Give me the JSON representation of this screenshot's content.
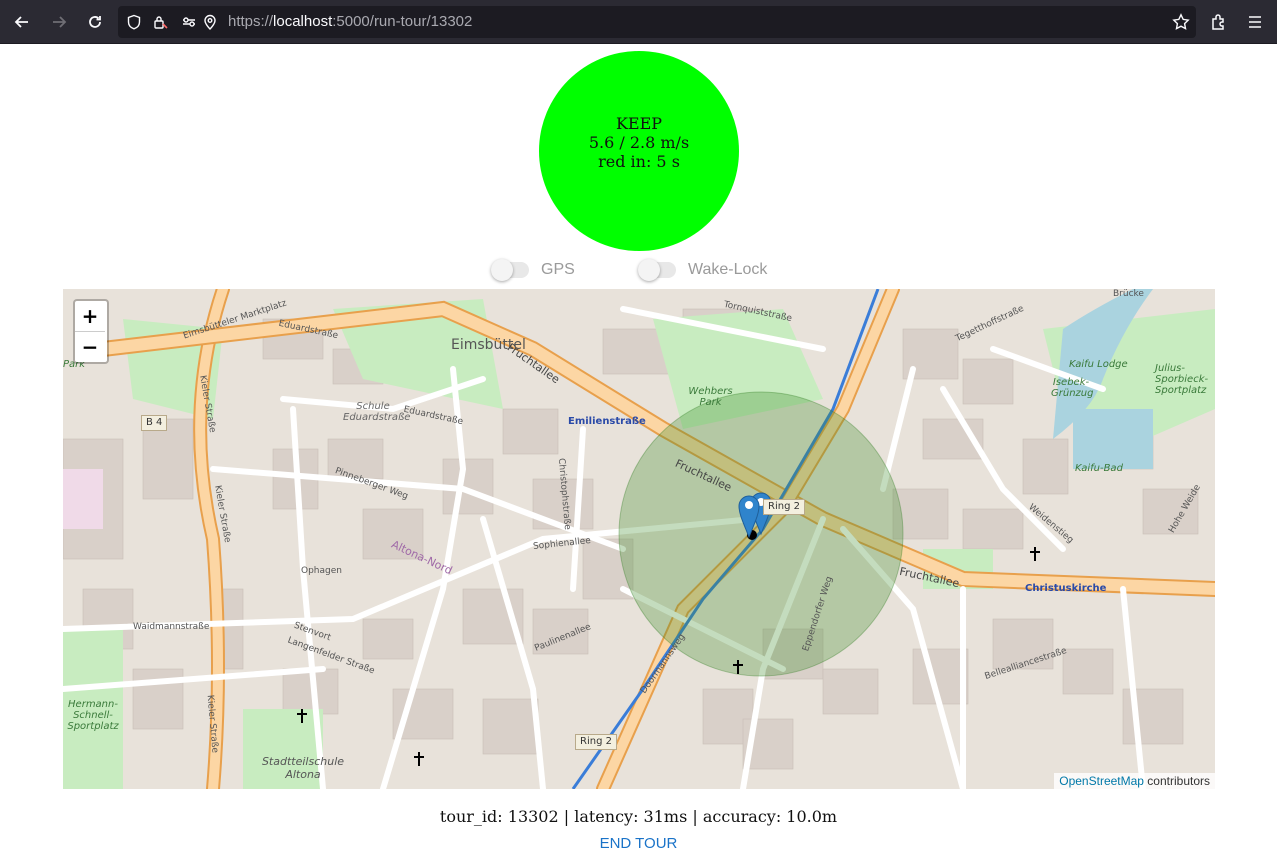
{
  "browser": {
    "url_prefix": "https://",
    "url_host": "localhost",
    "url_rest": ":5000/run-tour/13302",
    "icons": [
      "back-arrow-icon",
      "forward-arrow-icon",
      "reload-icon",
      "shield-icon",
      "lock-icon",
      "permissions-icon",
      "location-icon",
      "star-icon",
      "extensions-icon",
      "menu-icon"
    ]
  },
  "status": {
    "line1": "KEEP",
    "line2": "5.6 / 2.8 m/s",
    "line3": "red in: 5 s",
    "color": "#00ff00"
  },
  "toggles": {
    "gps": {
      "label": "GPS",
      "on": false
    },
    "wakelock": {
      "label": "Wake-Lock",
      "on": false
    }
  },
  "map": {
    "zoom_in": "+",
    "zoom_out": "−",
    "attribution_link": "OpenStreetMap",
    "attribution_text": " contributors",
    "labels": {
      "eimsbuettel": "Eimsbüttel",
      "fruchtallee1": "Fruchtallee",
      "fruchtallee2": "Fruchtallee",
      "fruchtallee3": "Fruchtallee",
      "emilienstrasse": "Emilienstraße",
      "wehbers_park": "Wehbers Park",
      "christuskirche": "Christuskirche",
      "kaifu_lodge": "Kaifu Lodge",
      "julius_sportplatz": "Julius-Sporbieck-Sportplatz",
      "isebek": "Isebek-Grünzug",
      "kaifu_bad": "Kaifu-Bad",
      "marktplatz": "Eimsbütteler Marktplatz",
      "eduardstrasse1": "Eduardstraße",
      "eduardstrasse2": "Eduardstraße",
      "schule": "Schule Eduardstraße",
      "kieler1": "Kieler Straße",
      "kieler2": "Kieler Straße",
      "kieler3": "Kieler Straße",
      "pinneberger": "Pinneberger Weg",
      "sophienallee": "Sophienallee",
      "ophagen": "Ophagen",
      "altona_nord": "Altona-Nord",
      "stadtteilschule": "Stadtteilschule Altona",
      "hermann": "Hermann-Schnell-Sportplatz",
      "waidmann": "Waidmannstraße",
      "langenfelder": "Langenfelder Straße",
      "paulinenallee": "Paulinenallee",
      "eppendorfer": "Eppendorfer Weg",
      "doormannsweg": "Doormannsweg",
      "christophstr": "Christophstraße",
      "tornquist": "Tornquiststraße",
      "tegetthoff": "Tegetthoffstraße",
      "weidenstieg": "Weidenstieg",
      "bellealliance": "Bellealliancestraße",
      "park": "Park",
      "bruecke": "Brücke",
      "stervort": "Stenvort",
      "hohe_weide": "Hohe Weide"
    },
    "shields": {
      "b4": "B 4",
      "ring2a": "Ring 2",
      "ring2b": "Ring 2"
    }
  },
  "footer": {
    "info": "tour_id: 13302 | latency: 31ms | accuracy: 10.0m",
    "end_tour": "END TOUR"
  }
}
